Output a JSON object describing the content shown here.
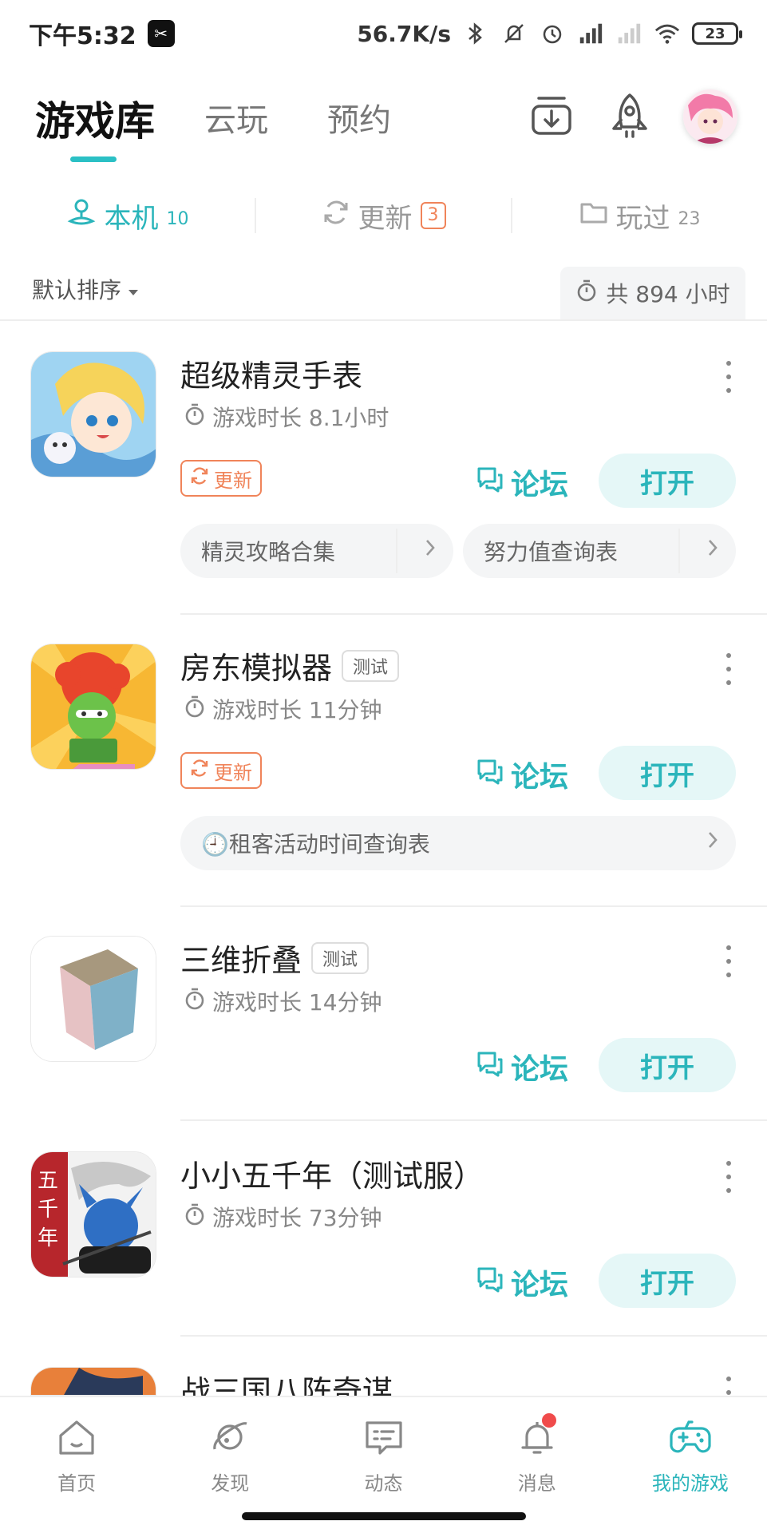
{
  "status_bar": {
    "time": "下午5:32",
    "app_glyph": "✂",
    "net_speed": "56.7K/s",
    "battery": "23"
  },
  "top_tabs": [
    {
      "label": "游戏库"
    },
    {
      "label": "云玩"
    },
    {
      "label": "预约"
    }
  ],
  "sub_tabs": [
    {
      "label": "本机",
      "count": "10"
    },
    {
      "label": "更新",
      "count": "3"
    },
    {
      "label": "玩过",
      "count": "23"
    }
  ],
  "sort": {
    "label": "默认排序"
  },
  "total_time": "共 894 小时",
  "games": [
    {
      "title": "超级精灵手表",
      "time": "游戏时长 8.1小时",
      "update_label": "更新",
      "forum_label": "论坛",
      "open_label": "打开",
      "chips": [
        "精灵攻略合集",
        "努力值查询表"
      ]
    },
    {
      "title": "房东模拟器",
      "tag": "测试",
      "time": "游戏时长 11分钟",
      "update_label": "更新",
      "forum_label": "论坛",
      "open_label": "打开",
      "chips": [
        "🕘租客活动时间查询表"
      ]
    },
    {
      "title": "三维折叠",
      "tag": "测试",
      "time": "游戏时长 14分钟",
      "forum_label": "论坛",
      "open_label": "打开"
    },
    {
      "title": "小小五千年（测试服）",
      "time": "游戏时长 73分钟",
      "forum_label": "论坛",
      "open_label": "打开"
    },
    {
      "title": "战三国八阵奇谋"
    }
  ],
  "bottom_nav": [
    {
      "label": "首页",
      "icon": "home-icon"
    },
    {
      "label": "发现",
      "icon": "planet-icon"
    },
    {
      "label": "动态",
      "icon": "message-card-icon"
    },
    {
      "label": "消息",
      "icon": "bell-icon"
    },
    {
      "label": "我的游戏",
      "icon": "gamepad-icon"
    }
  ],
  "colors": {
    "accent": "#2bb5bb",
    "update": "#f0845a",
    "badge_red": "#f04b4b"
  }
}
